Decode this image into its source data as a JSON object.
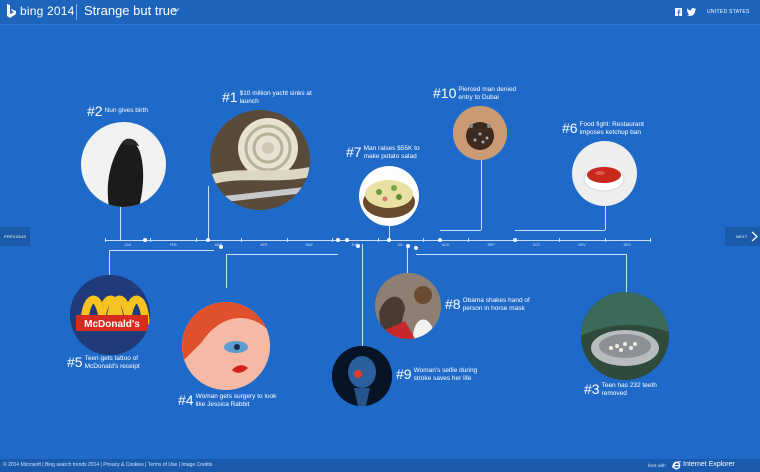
{
  "header": {
    "brand": "bing 2014",
    "title": "Strange but true",
    "social": [
      "facebook-icon",
      "twitter-icon"
    ],
    "country": "UNITED STATES"
  },
  "timeline": {
    "months": [
      "JAN",
      "FEB",
      "MAR",
      "APR",
      "MAY",
      "JUN",
      "JUL",
      "AUG",
      "SEP",
      "OCT",
      "NOV",
      "DEC"
    ]
  },
  "stories": [
    {
      "rank": "#1",
      "text": "$10 million yacht sinks at launch"
    },
    {
      "rank": "#2",
      "text": "Nun gives birth"
    },
    {
      "rank": "#3",
      "text": "Teen has 232 teeth removed"
    },
    {
      "rank": "#4",
      "text": "Woman gets surgery to look like Jessica Rabbit"
    },
    {
      "rank": "#5",
      "text": "Teen gets tattoo of McDonald's receipt"
    },
    {
      "rank": "#6",
      "text": "Food fight: Restaurant imposes ketchup ban"
    },
    {
      "rank": "#7",
      "text": "Man raises $55K to make potato salad"
    },
    {
      "rank": "#8",
      "text": "Obama shakes hand of person in horse mask"
    },
    {
      "rank": "#9",
      "text": "Woman's selfie during stroke saves her life"
    },
    {
      "rank": "#10",
      "text": "Pierced man denied entry to Dubai"
    }
  ],
  "nav": {
    "previous": "PREVIOUS",
    "next": "NEXT"
  },
  "footer": {
    "text": "© 2014 Microsoft | Bing search trends 2014 | Privacy & Cookies | Terms of Use | Image Credits",
    "best_with": "best with",
    "browser": "Internet Explorer"
  },
  "colors": {
    "background": "#1f6ac8",
    "header": "#1d64bd",
    "footer": "#1a5aad"
  }
}
